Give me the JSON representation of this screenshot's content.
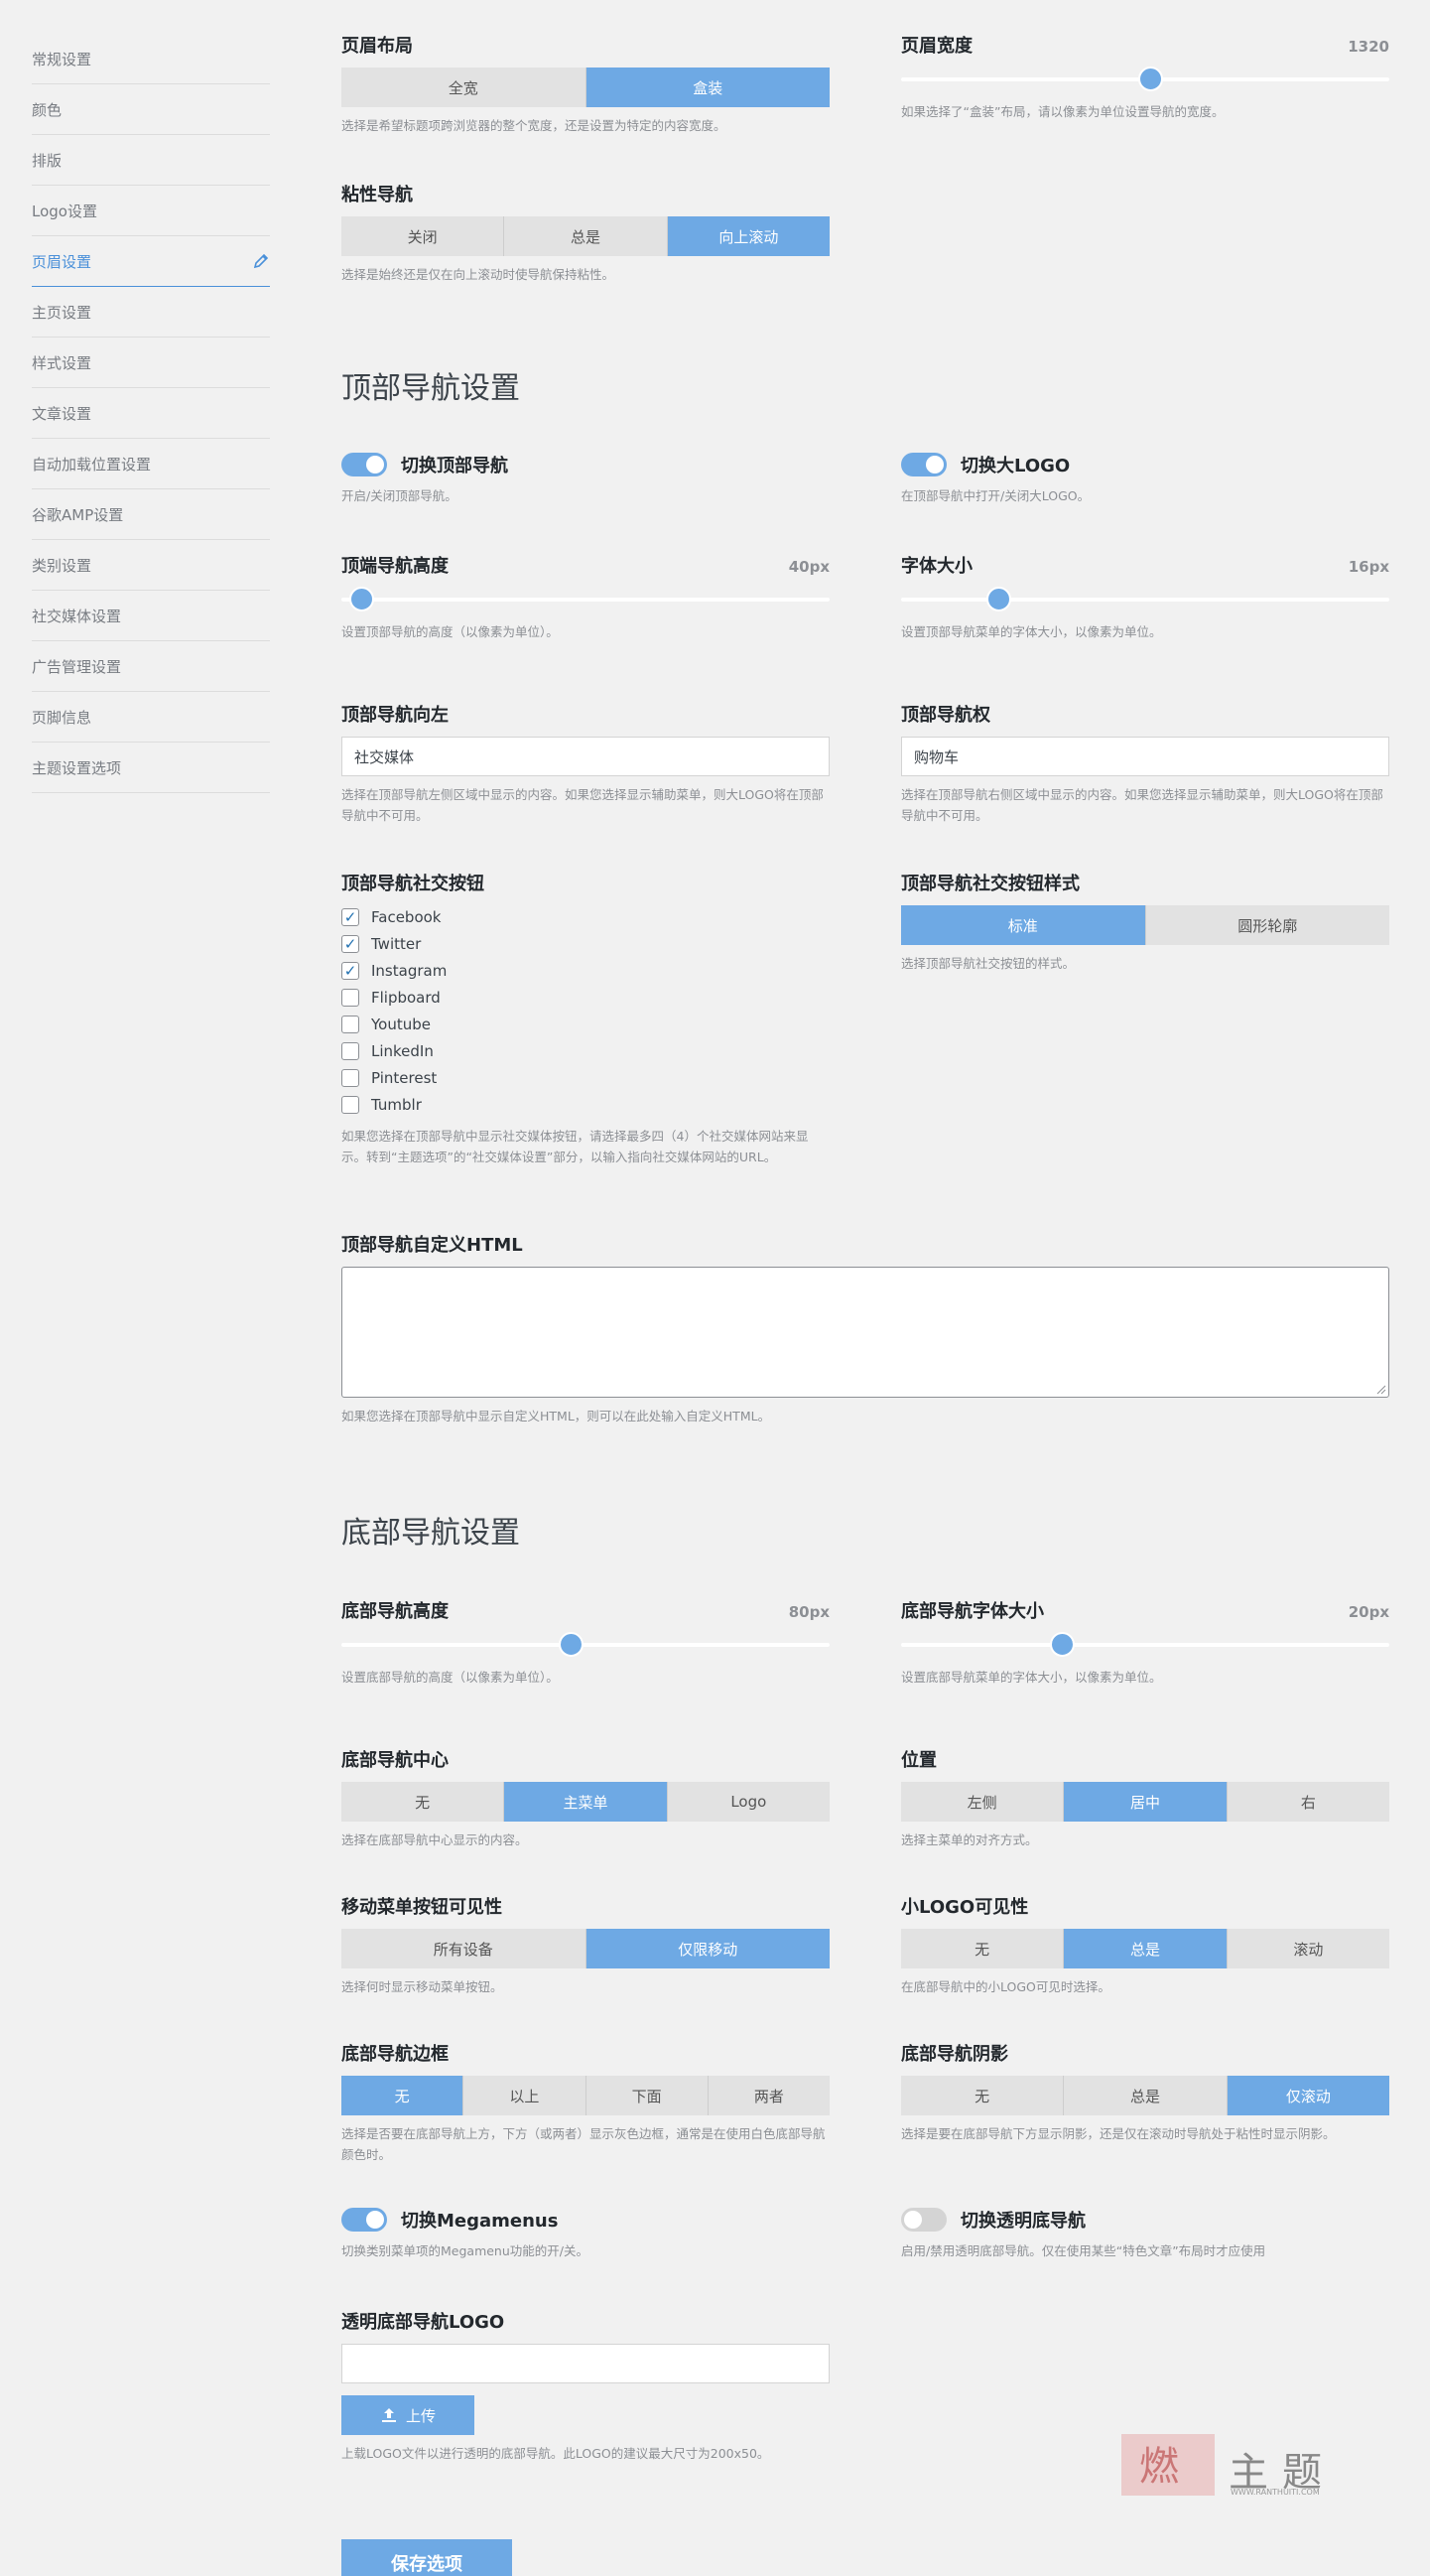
{
  "sidebar": {
    "items": [
      {
        "label": "常规设置"
      },
      {
        "label": "颜色"
      },
      {
        "label": "排版"
      },
      {
        "label": "Logo设置"
      },
      {
        "label": "页眉设置"
      },
      {
        "label": "主页设置"
      },
      {
        "label": "样式设置"
      },
      {
        "label": "文章设置"
      },
      {
        "label": "自动加载位置设置"
      },
      {
        "label": "谷歌AMP设置"
      },
      {
        "label": "类别设置"
      },
      {
        "label": "社交媒体设置"
      },
      {
        "label": "广告管理设置"
      },
      {
        "label": "页脚信息"
      },
      {
        "label": "主题设置选项"
      }
    ],
    "active_index": 4
  },
  "header_layout": {
    "label": "页眉布局",
    "options": [
      "全宽",
      "盒装"
    ],
    "selected": "盒装",
    "desc": "选择是希望标题项跨浏览器的整个宽度，还是设置为特定的内容宽度。"
  },
  "header_width": {
    "label": "页眉宽度",
    "value": "1320",
    "slider_fraction": 0.51,
    "desc": "如果选择了“盒装”布局，请以像素为单位设置导航的宽度。"
  },
  "sticky_nav": {
    "label": "粘性导航",
    "options": [
      "关闭",
      "总是",
      "向上滚动"
    ],
    "selected": "向上滚动",
    "desc": "选择是始终还是仅在向上滚动时使导航保持粘性。"
  },
  "top_nav": {
    "title": "顶部导航设置",
    "toggle_top": {
      "label": "切换顶部导航",
      "on": true,
      "desc": "开启/关闭顶部导航。"
    },
    "toggle_logo": {
      "label": "切换大LOGO",
      "on": true,
      "desc": "在顶部导航中打开/关闭大LOGO。"
    },
    "height": {
      "label": "顶端导航高度",
      "value": "40px",
      "slider_fraction": 0.04,
      "desc": "设置顶部导航的高度（以像素为单位）。"
    },
    "font_size": {
      "label": "字体大小",
      "value": "16px",
      "slider_fraction": 0.2,
      "desc": "设置顶部导航菜单的字体大小，以像素为单位。"
    },
    "nav_left": {
      "label": "顶部导航向左",
      "value": "社交媒体",
      "desc": "选择在顶部导航左侧区域中显示的内容。如果您选择显示辅助菜单，则大LOGO将在顶部导航中不可用。"
    },
    "nav_right": {
      "label": "顶部导航权",
      "value": "购物车",
      "desc": "选择在顶部导航右侧区域中显示的内容。如果您选择显示辅助菜单，则大LOGO将在顶部导航中不可用。"
    },
    "social": {
      "label": "顶部导航社交按钮",
      "items": [
        {
          "name": "Facebook",
          "checked": true
        },
        {
          "name": "Twitter",
          "checked": true
        },
        {
          "name": "Instagram",
          "checked": true
        },
        {
          "name": "Flipboard",
          "checked": false
        },
        {
          "name": "Youtube",
          "checked": false
        },
        {
          "name": "LinkedIn",
          "checked": false
        },
        {
          "name": "Pinterest",
          "checked": false
        },
        {
          "name": "Tumblr",
          "checked": false
        }
      ],
      "desc": "如果您选择在顶部导航中显示社交媒体按钮，请选择最多四（4）个社交媒体网站来显示。转到“主题选项”的“社交媒体设置”部分，以输入指向社交媒体网站的URL。"
    },
    "social_style": {
      "label": "顶部导航社交按钮样式",
      "options": [
        "标准",
        "圆形轮廓"
      ],
      "selected": "标准",
      "desc": "选择顶部导航社交按钮的样式。"
    },
    "custom_html": {
      "label": "顶部导航自定义HTML",
      "desc": "如果您选择在顶部导航中显示自定义HTML，则可以在此处输入自定义HTML。"
    }
  },
  "bottom_nav": {
    "title": "底部导航设置",
    "height": {
      "label": "底部导航高度",
      "value": "80px",
      "slider_fraction": 0.47,
      "desc": "设置底部导航的高度（以像素为单位）。"
    },
    "font_size": {
      "label": "底部导航字体大小",
      "value": "20px",
      "slider_fraction": 0.33,
      "desc": "设置底部导航菜单的字体大小，以像素为单位。"
    },
    "center": {
      "label": "底部导航中心",
      "options": [
        "无",
        "主菜单",
        "Logo"
      ],
      "selected": "主菜单",
      "desc": "选择在底部导航中心显示的内容。"
    },
    "position": {
      "label": "位置",
      "options": [
        "左侧",
        "居中",
        "右"
      ],
      "selected": "居中",
      "desc": "选择主菜单的对齐方式。"
    },
    "mobile_btn": {
      "label": "移动菜单按钮可见性",
      "options": [
        "所有设备",
        "仅限移动"
      ],
      "selected": "仅限移动",
      "desc": "选择何时显示移动菜单按钮。"
    },
    "small_logo": {
      "label": "小LOGO可见性",
      "options": [
        "无",
        "总是",
        "滚动"
      ],
      "selected": "总是",
      "desc": "在底部导航中的小LOGO可见时选择。"
    },
    "border": {
      "label": "底部导航边框",
      "options": [
        "无",
        "以上",
        "下面",
        "两者"
      ],
      "selected": "无",
      "desc": "选择是否要在底部导航上方，下方（或两者）显示灰色边框，通常是在使用白色底部导航颜色时。"
    },
    "shadow": {
      "label": "底部导航阴影",
      "options": [
        "无",
        "总是",
        "仅滚动"
      ],
      "selected": "仅滚动",
      "desc": "选择是要在底部导航下方显示阴影，还是仅在滚动时导航处于粘性时显示阴影。"
    },
    "megamenus": {
      "label": "切换Megamenus",
      "on": true,
      "desc": "切换类别菜单项的Megamenu功能的开/关。"
    },
    "transparent": {
      "label": "切换透明底导航",
      "on": false,
      "desc": "启用/禁用透明底部导航。仅在使用某些“特色文章”布局时才应使用"
    },
    "transparent_logo": {
      "label": "透明底部导航LOGO",
      "upload_label": "上传",
      "desc": "上载LOGO文件以进行透明的底部导航。此LOGO的建议最大尺寸为200x50。"
    }
  },
  "save_label": "保存选项",
  "watermark": {
    "text": "主题",
    "small": "WWW.RANTHUITI.COM"
  },
  "colors": {
    "accent": "#6ea9e4",
    "active_nav": "#4a90d9"
  }
}
